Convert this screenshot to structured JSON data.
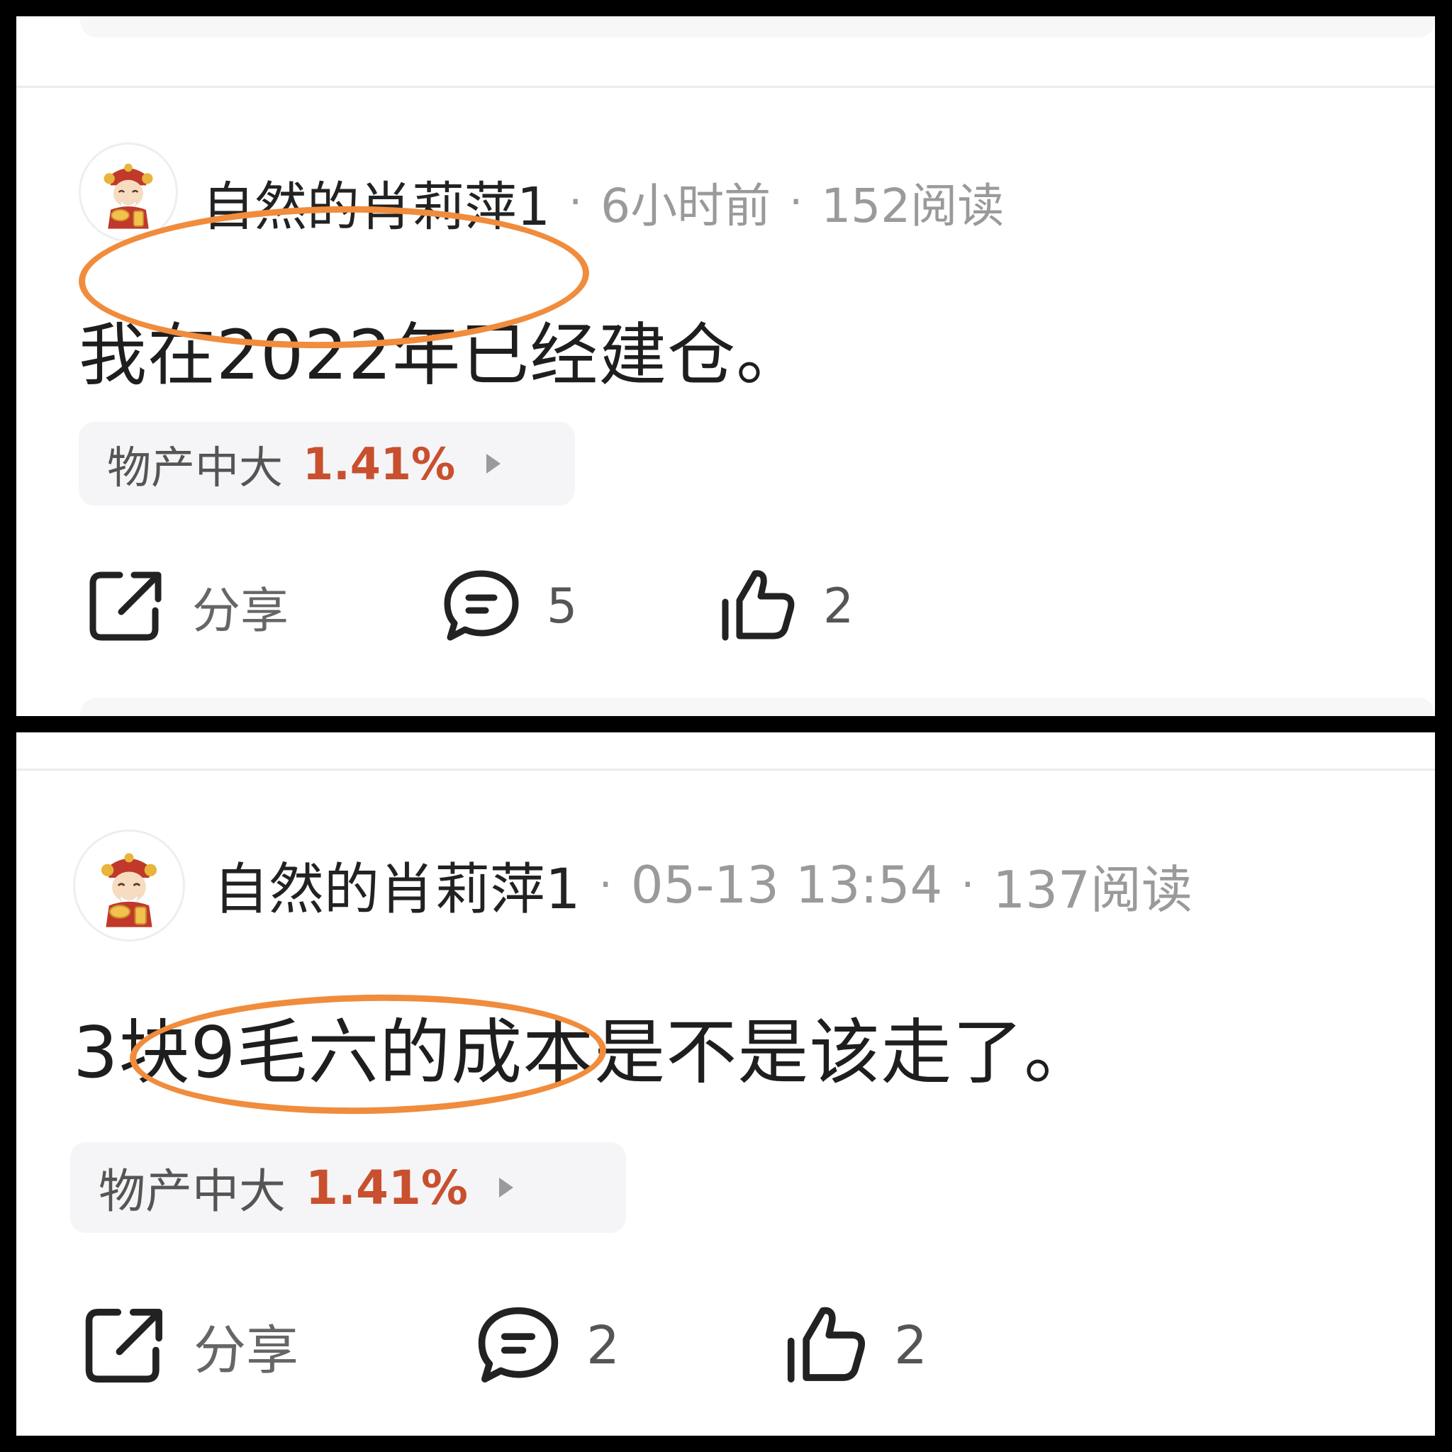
{
  "posts": [
    {
      "username": "自然的肖莉萍1",
      "time": "6小时前",
      "reads": "152阅读",
      "content": "我在2022年已经建仓。",
      "stock": {
        "name": "物产中大",
        "change": "1.41%"
      },
      "actions": {
        "share_label": "分享",
        "comment_count": "5",
        "like_count": "2"
      }
    },
    {
      "username": "自然的肖莉萍1",
      "time": "05-13 13:54",
      "reads": "137阅读",
      "content": "3块9毛六的成本是不是该走了。",
      "stock": {
        "name": "物产中大",
        "change": "1.41%"
      },
      "actions": {
        "share_label": "分享",
        "comment_count": "2",
        "like_count": "2"
      }
    }
  ],
  "meta_separator": "·",
  "icons": [
    "share-icon",
    "comment-icon",
    "thumbs-up-icon",
    "play-arrow-icon",
    "avatar-fortune-god"
  ],
  "colors": {
    "stock_up": "#c8502e",
    "annotation": "#f08c3c",
    "meta_gray": "#9a9a9a"
  }
}
